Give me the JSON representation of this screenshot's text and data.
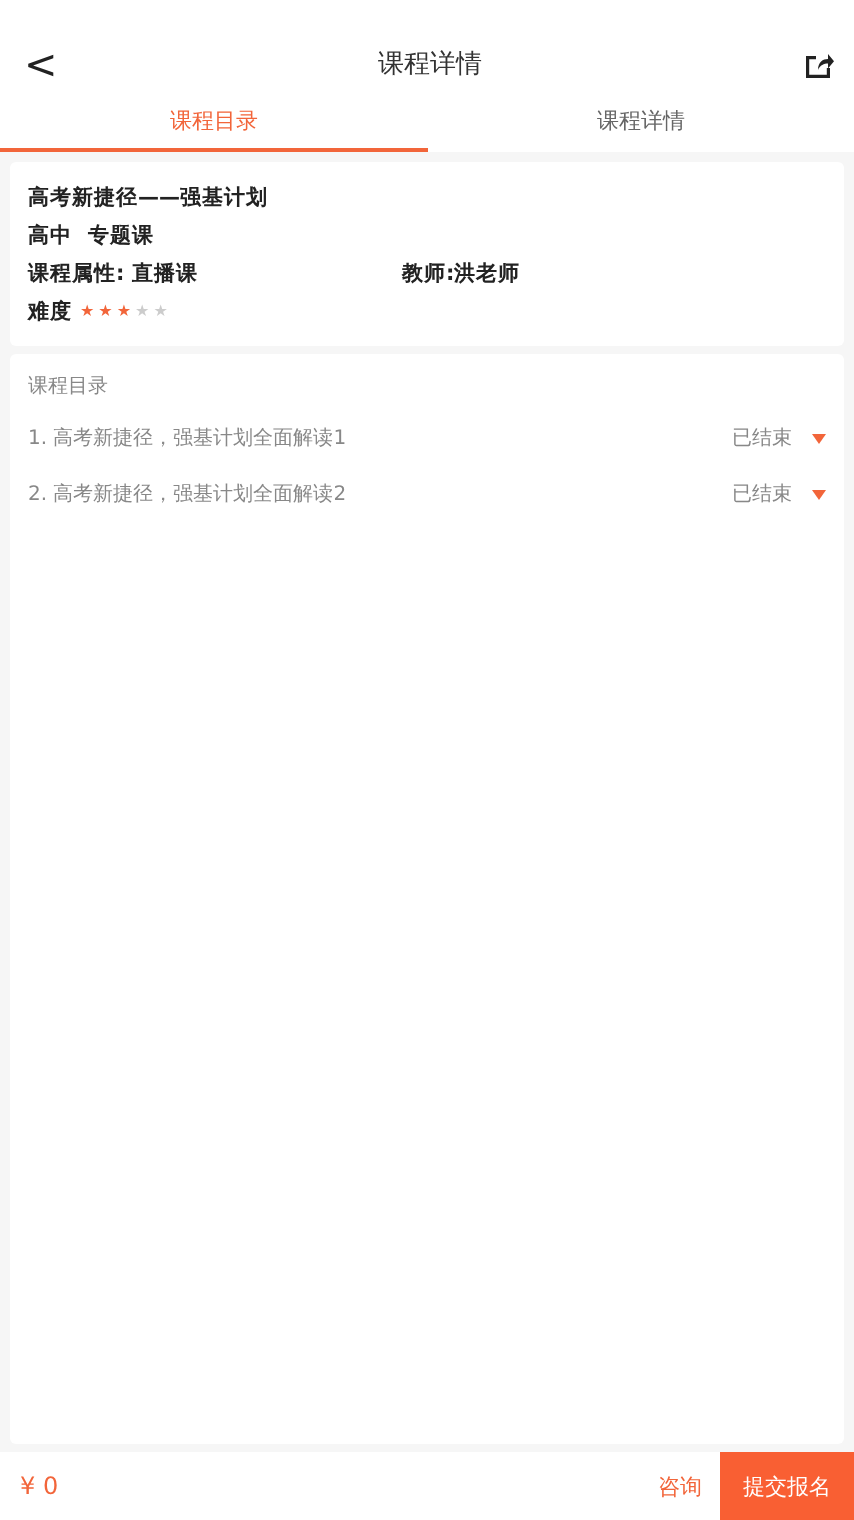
{
  "header": {
    "back": "<",
    "title": "课程详情"
  },
  "tabs": [
    {
      "label": "课程目录",
      "selected": true
    },
    {
      "label": "课程详情",
      "selected": false
    }
  ],
  "course": {
    "name": "高考新捷径——强基计划",
    "level": "高中",
    "type": "专题课",
    "attribute": "课程属性: 直播课",
    "teacher": "教师:洪老师",
    "difficulty_label": "难度",
    "stars": 3
  },
  "catalog": {
    "title": "课程目录",
    "lessons": [
      {
        "title": "1. 高考新捷径，强基计划全面解读1",
        "status": "已结束"
      },
      {
        "title": "2. 高考新捷径，强基计划全面解读2",
        "status": "已结束"
      }
    ]
  },
  "footer": {
    "price": "¥ 0",
    "consult": "咨询",
    "submit": "提交报名"
  }
}
